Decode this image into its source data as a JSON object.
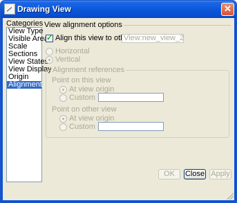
{
  "window": {
    "title": "Drawing View",
    "close_glyph": "✕"
  },
  "categories": {
    "header": "Categories",
    "items": [
      {
        "label": "View Type"
      },
      {
        "label": "Visible Area"
      },
      {
        "label": "Scale"
      },
      {
        "label": "Sections"
      },
      {
        "label": "View States"
      },
      {
        "label": "View Display"
      },
      {
        "label": "Origin"
      },
      {
        "label": "Alignment",
        "selected": true
      }
    ]
  },
  "alignment": {
    "section_title": "View alignment options",
    "align_checkbox_label": "Align this view to other view",
    "align_checked": true,
    "other_view_value": "View:new_view_2",
    "horizontal_label": "Horizontal",
    "vertical_label": "Vertical",
    "orientation_selected": "Vertical",
    "references": {
      "title": "Alignment references",
      "this_view_title": "Point on this view",
      "other_view_title": "Point on other view",
      "at_origin_label": "At view origin",
      "custom_label": "Custom",
      "this_view_selected": "At view origin",
      "other_view_selected": "At view origin",
      "this_custom_value": "",
      "other_custom_value": ""
    }
  },
  "buttons": {
    "ok": "OK",
    "close": "Close",
    "apply": "Apply"
  }
}
